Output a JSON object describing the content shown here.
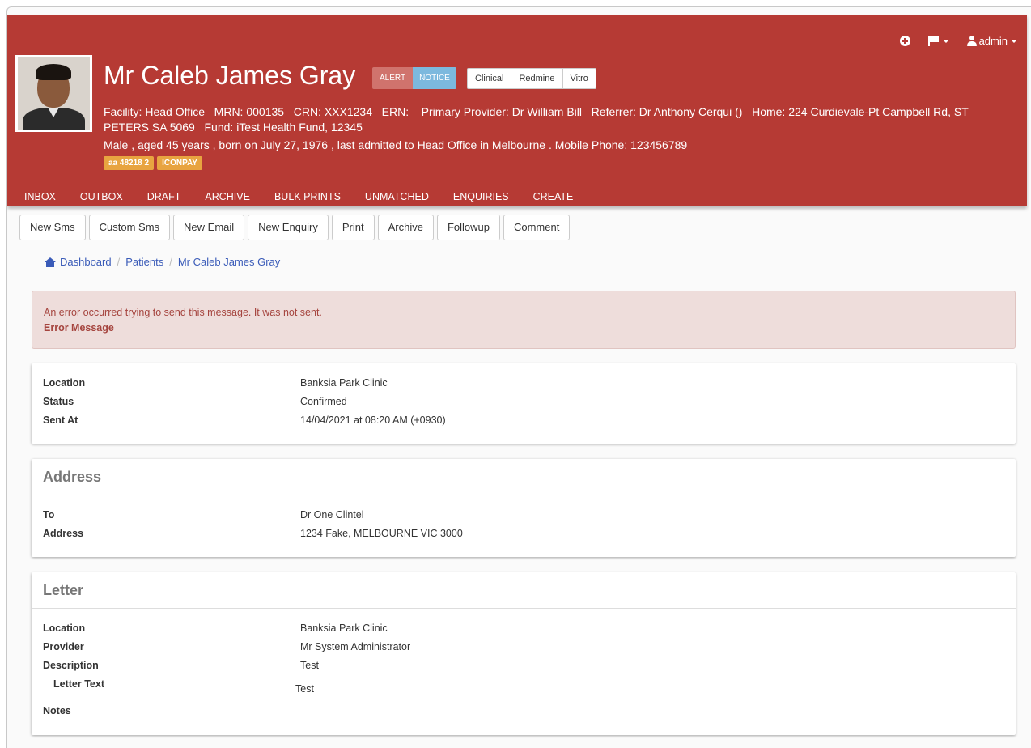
{
  "topbar": {
    "user": "admin"
  },
  "patient": {
    "name": "Mr Caleb James Gray",
    "alert_label": "ALERT",
    "notice_label": "NOTICE",
    "links": [
      "Clinical",
      "Redmine",
      "Vitro"
    ],
    "info_line_1": "Facility: Head Office   MRN: 000135   CRN: XXX1234   ERN:    Primary Provider: Dr William Bill   Referrer: Dr Anthony Cerqui ()   Home: 224 Curdievale-Pt Campbell Rd, ST",
    "info_line_2": "PETERS SA 5069   Fund: iTest Health Fund, 12345",
    "info_line_3": "Male , aged 45 years , born on July 27, 1976 , last admitted to Head Office in Melbourne . Mobile Phone: 123456789",
    "tags": [
      "aa 48218 2",
      "ICONPAY"
    ]
  },
  "nav": [
    "INBOX",
    "OUTBOX",
    "DRAFT",
    "ARCHIVE",
    "BULK PRINTS",
    "UNMATCHED",
    "ENQUIRIES",
    "CREATE"
  ],
  "toolbar": [
    "New Sms",
    "Custom Sms",
    "New Email",
    "New Enquiry",
    "Print",
    "Archive",
    "Followup",
    "Comment"
  ],
  "breadcrumb": {
    "home": "Dashboard",
    "patients": "Patients",
    "current": "Mr Caleb James Gray"
  },
  "alert": {
    "message": "An error occurred trying to send this message. It was not sent.",
    "title": "Error Message"
  },
  "summary": {
    "location_label": "Location",
    "location": "Banksia Park Clinic",
    "status_label": "Status",
    "status": "Confirmed",
    "sent_label": "Sent At",
    "sent": "14/04/2021 at 08:20 AM (+0930)"
  },
  "address": {
    "title": "Address",
    "to_label": "To",
    "to": "Dr One Clintel",
    "address_label": "Address",
    "address": "1234 Fake, MELBOURNE VIC 3000"
  },
  "letter": {
    "title": "Letter",
    "location_label": "Location",
    "location": "Banksia Park Clinic",
    "provider_label": "Provider",
    "provider": "Mr System Administrator",
    "description_label": "Description",
    "description": "Test",
    "letter_text_label": "Letter Text",
    "letter_text": "Test",
    "notes_label": "Notes"
  }
}
